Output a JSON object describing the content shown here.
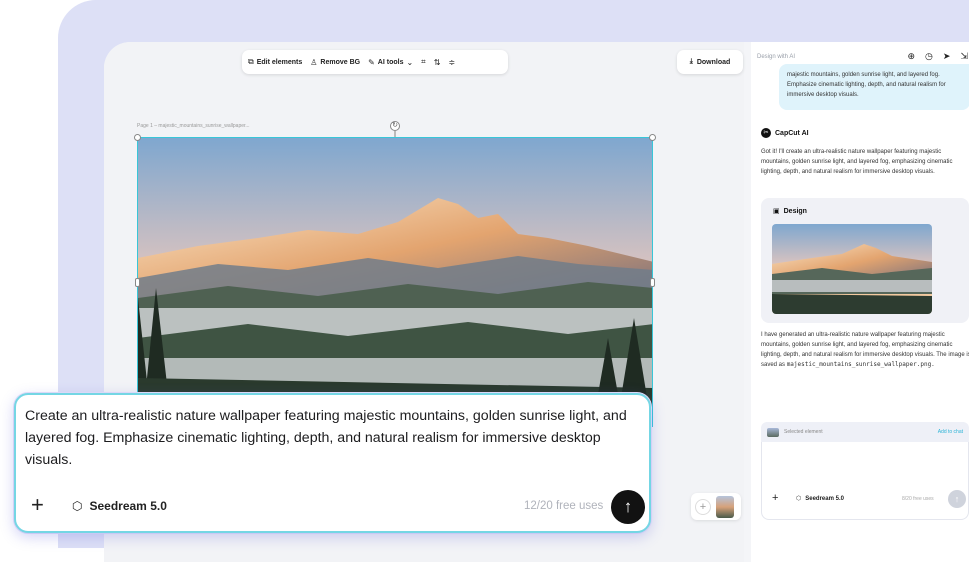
{
  "toolbar": {
    "edit_elements": "Edit elements",
    "remove_bg": "Remove BG",
    "ai_tools": "AI tools",
    "download": "Download"
  },
  "canvas": {
    "page_label": "Page 1 – majestic_mountains_sunrise_wallpaper..."
  },
  "panel": {
    "header": "Design with AI",
    "user_message": "majestic mountains, golden sunrise light, and layered fog. Emphasize cinematic lighting, depth, and natural realism for immersive desktop visuals.",
    "ai_name": "CapCut AI",
    "ai_reply": "Got it! I'll create an ultra-realistic nature wallpaper featuring majestic mountains, golden sunrise light, and layered fog, emphasizing cinematic lighting, depth, and natural realism for immersive desktop visuals.",
    "design_title": "Design",
    "ai_result": "I have generated an ultra-realistic nature wallpaper featuring majestic mountains, golden sunrise light, and layered fog, emphasizing cinematic lighting, depth, and natural realism for immersive desktop visuals. The image is saved as",
    "filename": "majestic_mountains_sunrise_wallpaper.png.",
    "selected_element": "Selected element",
    "add_to_chat": "Add to chat",
    "model": "Seedream 5.0",
    "uses": "8/20 free uses"
  },
  "prompt": {
    "text": "Create an ultra-realistic nature wallpaper featuring majestic mountains, golden sunrise light, and layered fog. Emphasize cinematic lighting, depth, and natural realism for immersive desktop visuals.",
    "model": "Seedream 5.0",
    "uses": "12/20 free uses"
  },
  "colors": {
    "accent": "#38c6d8",
    "send": "#121212",
    "user_bubble": "#dff3fb"
  }
}
